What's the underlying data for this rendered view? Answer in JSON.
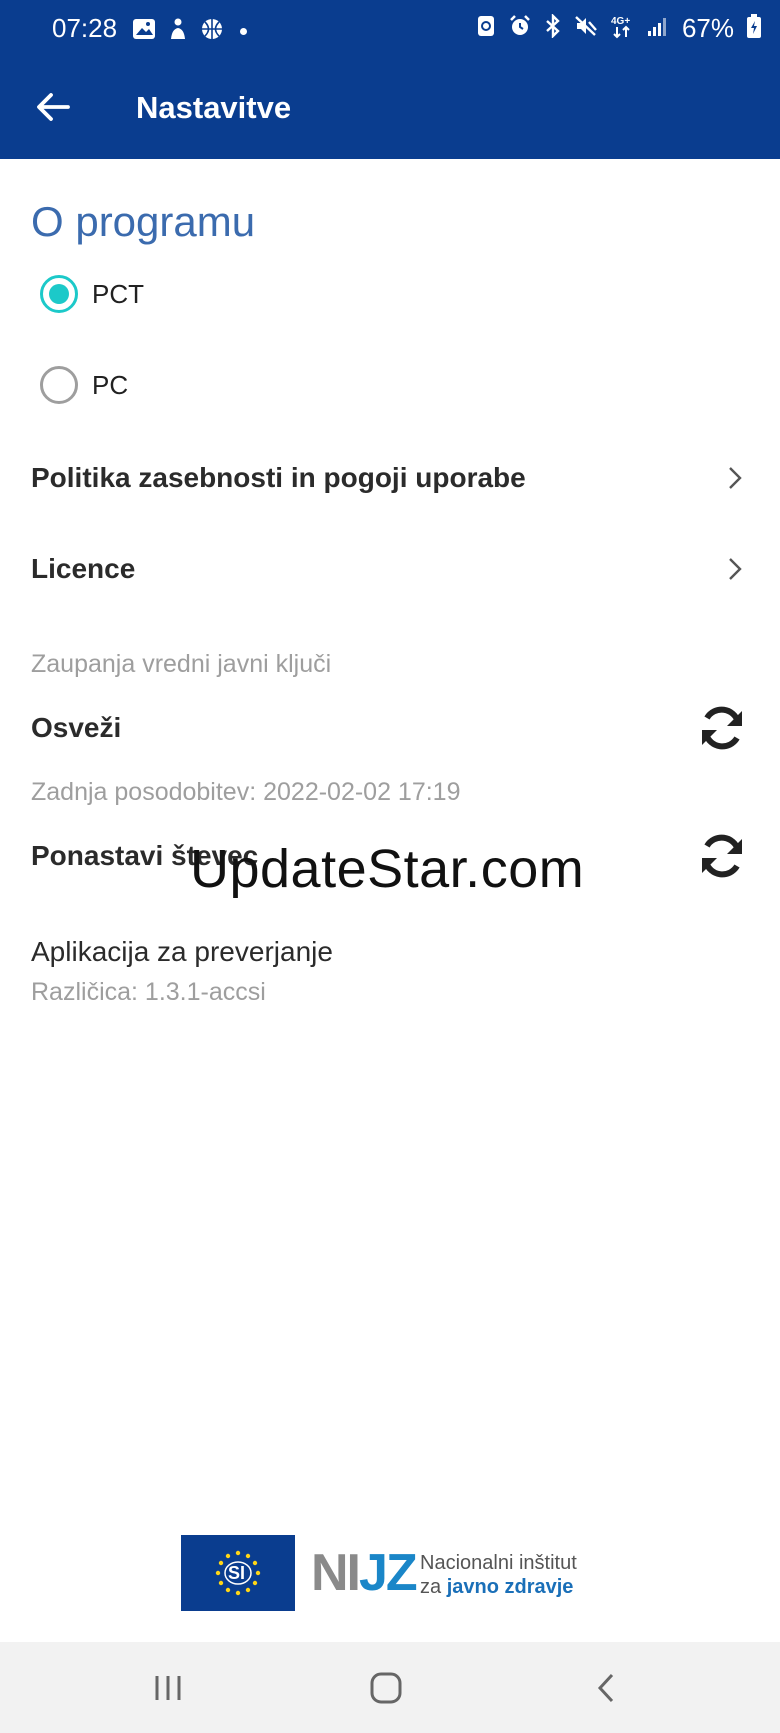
{
  "status_bar": {
    "time": "07:28",
    "battery": "67%",
    "left_icons": [
      "gallery-icon",
      "person-icon",
      "basketball-icon",
      "dot-icon"
    ],
    "right_icons": [
      "recycle-icon",
      "alarm-icon",
      "bluetooth-icon",
      "mute-icon",
      "4g-icon",
      "signal-icon",
      "battery-icon"
    ]
  },
  "app_bar": {
    "title": "Nastavitve"
  },
  "about": {
    "section_title": "O programu",
    "options": [
      {
        "label": "PCT",
        "selected": true
      },
      {
        "label": "PC",
        "selected": false
      }
    ],
    "links": [
      {
        "label": "Politika zasebnosti in pogoji uporabe"
      },
      {
        "label": "Licence"
      }
    ]
  },
  "keys": {
    "subheader": "Zaupanja vredni javni ključi",
    "refresh_label": "Osveži",
    "last_update": "Zadnja posodobitev: 2022-02-02 17:19",
    "reset_label": "Ponastavi števec"
  },
  "app_info": {
    "title": "Aplikacija za preverjanje",
    "version": "Različica: 1.3.1-accsi"
  },
  "watermark": "UpdateStar.com",
  "footer": {
    "eu_label": "SI",
    "nijz_letters_a": "NI",
    "nijz_letters_b": "JZ",
    "nijz_line1": "Nacionalni inštitut",
    "nijz_line2_prefix": "za ",
    "nijz_line2_strong": "javno zdravje"
  },
  "colors": {
    "primary": "#0a3d8f",
    "accent": "#1cc9c9",
    "section_title": "#3b6bae"
  }
}
